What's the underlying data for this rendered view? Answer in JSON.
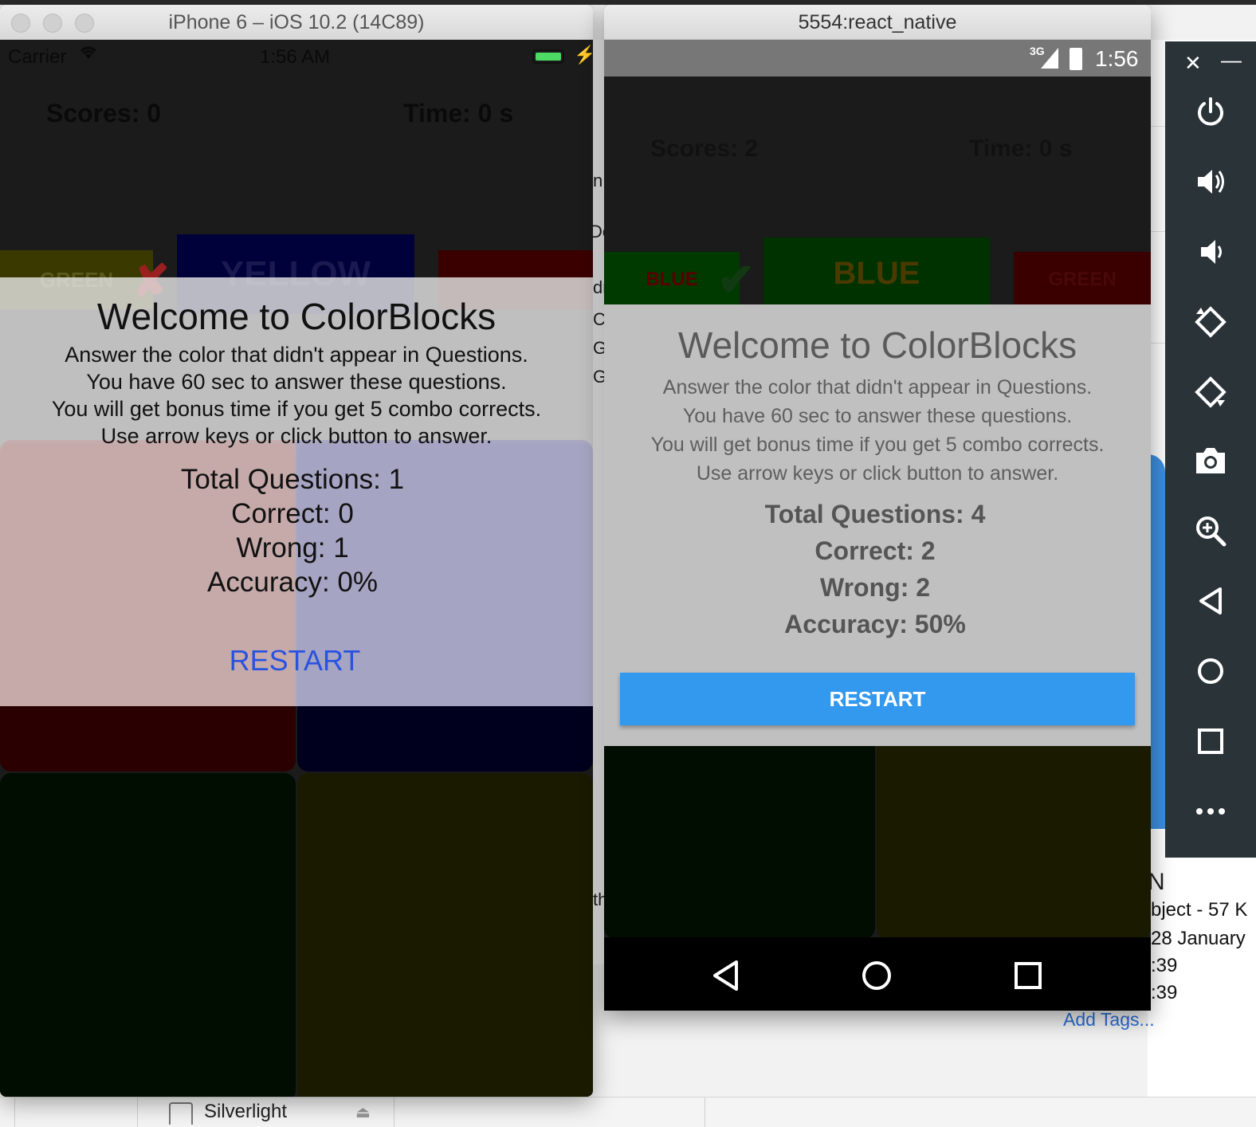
{
  "ios": {
    "window_title": "iPhone 6 – iOS 10.2 (14C89)",
    "status": {
      "carrier": "Carrier",
      "time": "1:56 AM"
    },
    "scores": "Scores: 0",
    "time": "Time: 0 s",
    "question_blocks": [
      {
        "label": "GREEN",
        "color": "#3a3a00"
      },
      {
        "label": "YELLOW",
        "color": "#00003a"
      },
      {
        "label": "",
        "color": "#3a0000"
      }
    ],
    "result_mark": "✘",
    "overlay": {
      "title": "Welcome to ColorBlocks",
      "lines": [
        "Answer the color that didn't appear in Questions.",
        "You have 60 sec to answer these questions.",
        "You will get bonus time if you get 5 combo corrects.",
        "Use arrow keys or click button to answer."
      ],
      "stats": [
        "Total Questions: 1",
        "Correct: 0",
        "Wrong: 1",
        "Accuracy: 0%"
      ],
      "restart": "RESTART"
    },
    "answer_colors": [
      "#2a0000",
      "#00001e",
      "#000d00",
      "#1a1a00"
    ]
  },
  "android": {
    "window_title": "5554:react_native",
    "status": {
      "network": "3G",
      "time": "1:56"
    },
    "scores": "Scores: 2",
    "time": "Time: 0 s",
    "question_blocks": [
      {
        "label": "BLUE",
        "color": "#003a00",
        "text_color": "#5a0000"
      },
      {
        "label": "BLUE",
        "color": "#003200",
        "text_color": "#4a3a00"
      },
      {
        "label": "GREEN",
        "color": "#3a0000",
        "text_color": "#3a0000"
      }
    ],
    "result_mark": "✔",
    "overlay": {
      "title": "Welcome to ColorBlocks",
      "lines": [
        "Answer the color that didn't appear in Questions.",
        "You have 60 sec to answer these questions.",
        "You will get bonus time if you get 5 combo corrects.",
        "Use arrow keys or click button to answer."
      ],
      "stats": [
        "Total Questions: 4",
        "Correct: 2",
        "Wrong: 2",
        "Accuracy: 50%"
      ],
      "restart": "RESTART"
    },
    "answer_colors": [
      "#000d00",
      "#1a1a00"
    ]
  },
  "emulator_toolbar": {
    "icons": [
      "power-icon",
      "volume-up-icon",
      "volume-down-icon",
      "rotate-left-icon",
      "rotate-right-icon",
      "camera-icon",
      "zoom-icon",
      "back-icon",
      "home-icon",
      "overview-icon",
      "more-icon"
    ]
  },
  "background": {
    "finder_item": "Silverlight",
    "behind_letters": [
      "n",
      "De",
      "dr",
      "C",
      "G",
      "G",
      "th"
    ],
    "info_lines": [
      "bject - 57 K",
      "28 January",
      ":39",
      ":39"
    ],
    "add_tags": "Add Tags...",
    "big_letter": "N"
  }
}
